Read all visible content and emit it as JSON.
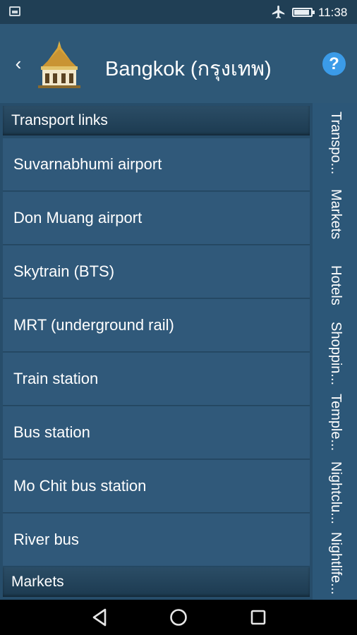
{
  "status_bar": {
    "time": "11:38",
    "icons": [
      "gallery-icon",
      "airplane-mode-icon",
      "battery-icon"
    ]
  },
  "app_bar": {
    "back_label": "‹",
    "title": "Bangkok (กรุงเทพ)",
    "help_label": "?",
    "logo_icon": "temple-icon"
  },
  "colors": {
    "background": "#2b5473",
    "list_item": "#30597a",
    "section_header": "#1c3a50",
    "help_button": "#3b9be8",
    "status_bar": "#203f55"
  },
  "sections": [
    {
      "header": "Transport links",
      "items": [
        "Suvarnabhumi airport",
        "Don Muang airport",
        "Skytrain (BTS)",
        "MRT (underground rail)",
        "Train station",
        "Bus station",
        "Mo Chit bus station",
        "River bus"
      ]
    },
    {
      "header": "Markets",
      "items": []
    }
  ],
  "side_index": [
    "Transpo...",
    "Markets",
    "Hotels",
    "Shoppin...",
    "Temple...",
    "Nightclu...",
    "Nightlife..."
  ],
  "nav_bar": {
    "icons": [
      "back-triangle-icon",
      "home-circle-icon",
      "recents-square-icon"
    ]
  }
}
